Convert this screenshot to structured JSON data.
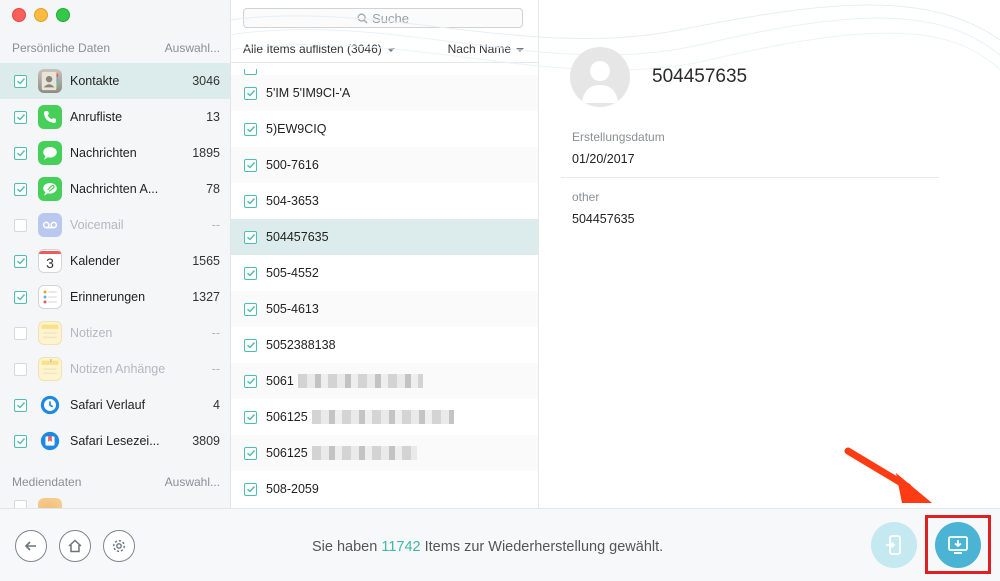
{
  "colors": {
    "accent": "#3fb8a8",
    "highlight": "#e02020",
    "arrow": "#ff3b14"
  },
  "sidebar": {
    "personal_header": "Persönliche Daten",
    "personal_select": "Auswahl...",
    "items": [
      {
        "label": "Kontakte",
        "count": "3046",
        "checked": true,
        "icon": "contacts-icon"
      },
      {
        "label": "Anrufliste",
        "count": "13",
        "checked": true,
        "icon": "phone-icon"
      },
      {
        "label": "Nachrichten",
        "count": "1895",
        "checked": true,
        "icon": "messages-icon"
      },
      {
        "label": "Nachrichten A...",
        "count": "78",
        "checked": true,
        "icon": "message-attachment-icon"
      },
      {
        "label": "Voicemail",
        "count": "--",
        "checked": false,
        "icon": "voicemail-icon"
      },
      {
        "label": "Kalender",
        "count": "1565",
        "checked": true,
        "icon": "calendar-icon",
        "icon_text": "3"
      },
      {
        "label": "Erinnerungen",
        "count": "1327",
        "checked": true,
        "icon": "reminders-icon"
      },
      {
        "label": "Notizen",
        "count": "--",
        "checked": false,
        "icon": "notes-icon"
      },
      {
        "label": "Notizen Anhänge",
        "count": "--",
        "checked": false,
        "icon": "notes-attachment-icon"
      },
      {
        "label": "Safari Verlauf",
        "count": "4",
        "checked": true,
        "icon": "safari-history-icon"
      },
      {
        "label": "Safari Lesezei...",
        "count": "3809",
        "checked": true,
        "icon": "safari-bookmarks-icon"
      }
    ],
    "media_header": "Mediendaten",
    "media_select": "Auswahl..."
  },
  "middle": {
    "search_placeholder": "Suche",
    "list_all": "Alle Items auflisten (3046)",
    "sort": "Nach Name",
    "items": [
      {
        "label": "5'IM 5'IM9CI-'A"
      },
      {
        "label": "5)EW9CIQ"
      },
      {
        "label": "500-7616"
      },
      {
        "label": "504-3653"
      },
      {
        "label": "504457635"
      },
      {
        "label": "505-4552"
      },
      {
        "label": "505-4613"
      },
      {
        "label": "5052388138"
      },
      {
        "label": "5061",
        "blurred": 1
      },
      {
        "label": "506125",
        "blurred": 2
      },
      {
        "label": "506125",
        "blurred": 3
      },
      {
        "label": "508-2059"
      }
    ]
  },
  "detail": {
    "name": "504457635",
    "created_label": "Erstellungsdatum",
    "created_value": "01/20/2017",
    "other_label": "other",
    "other_value": "504457635"
  },
  "footer": {
    "status_pre": "Sie haben ",
    "status_count": "11742",
    "status_post": " Items zur Wiederherstellung gewählt."
  }
}
